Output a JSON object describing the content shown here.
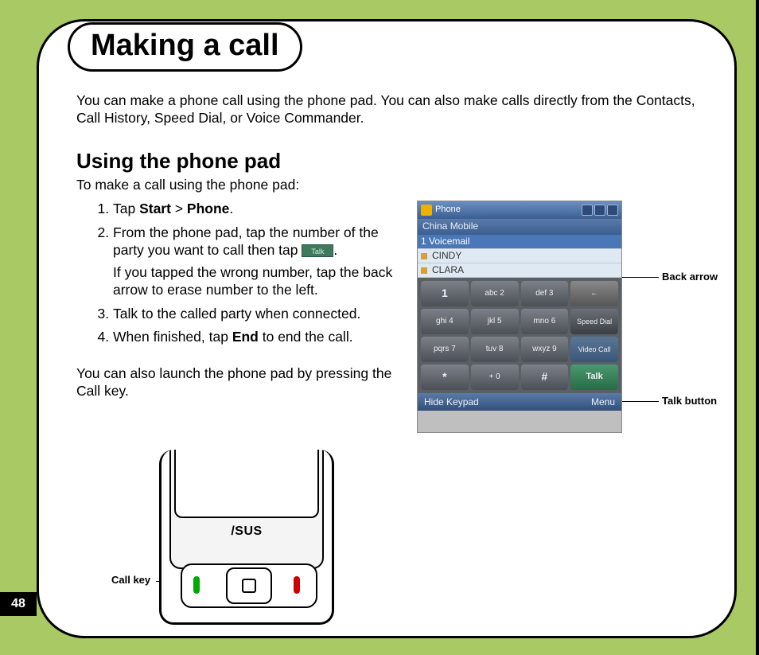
{
  "page_number": "48",
  "title": "Making a call",
  "intro": "You can make a phone call using the phone pad. You can also make calls directly from the Contacts, Call History, Speed Dial, or Voice Commander.",
  "section_heading": "Using the phone pad",
  "section_lead": "To make a call using the phone pad:",
  "steps": {
    "s1_pre": "Tap ",
    "s1_b1": "Start",
    "s1_mid": " > ",
    "s1_b2": "Phone",
    "s1_post": ".",
    "s2_a": "From the phone pad, tap the number of the party you want to call then tap ",
    "s2_b": ".",
    "s2_p2": "If you tapped the wrong number, tap the back arrow to erase number to the left.",
    "s3": "Talk to the called party when connected.",
    "s4_pre": "When finished, tap ",
    "s4_b": "End",
    "s4_post": " to end the call."
  },
  "after_steps": "You can also launch the phone pad by pressing the Call key.",
  "inline_talk_label": "Talk",
  "callouts": {
    "back_arrow": "Back arrow",
    "talk_button": "Talk button",
    "call_key": "Call key"
  },
  "screenshot": {
    "titlebar_app": "Phone",
    "carrier": "China Mobile",
    "list": [
      "1   Voicemail",
      "CINDY",
      "CLARA"
    ],
    "keys_row1": [
      "1",
      "abc 2",
      "def 3",
      "←"
    ],
    "keys_row2": [
      "ghi 4",
      "jkl 5",
      "mno 6",
      "Speed Dial"
    ],
    "keys_row3": [
      "pqrs 7",
      "tuv 8",
      "wxyz 9",
      "Video Call"
    ],
    "keys_row4": [
      "*",
      "+ 0",
      "#",
      "Talk"
    ],
    "soft_left": "Hide Keypad",
    "soft_right": "Menu"
  },
  "device_logo": "/SUS"
}
